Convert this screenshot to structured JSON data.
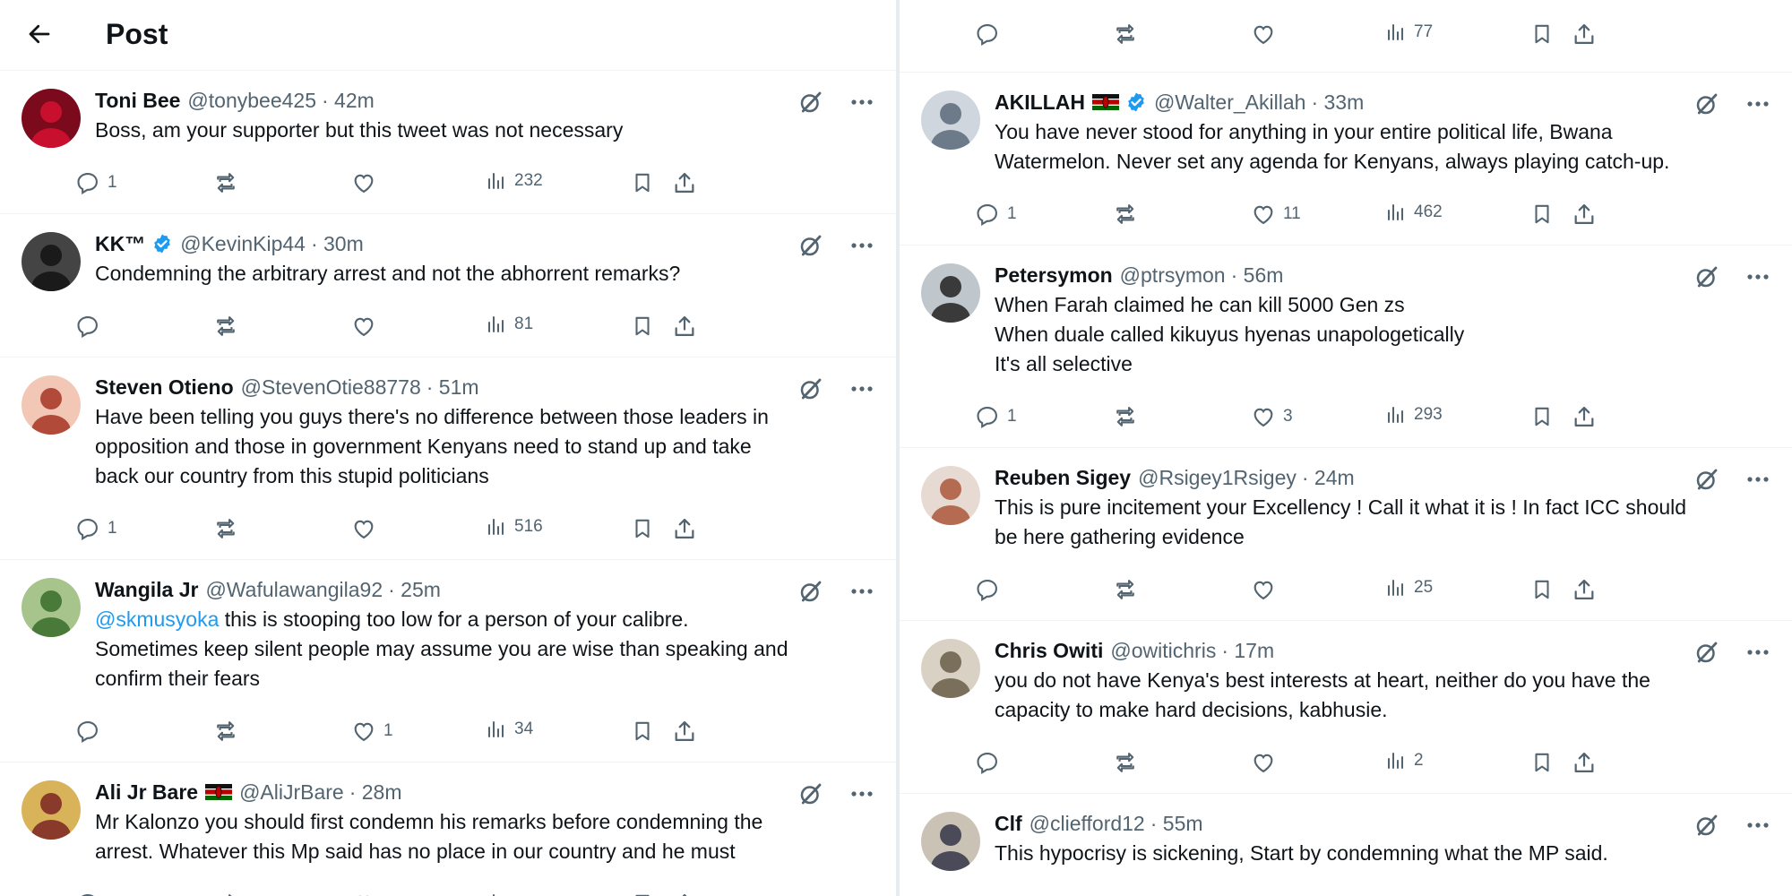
{
  "header": {
    "title": "Post"
  },
  "left_posts": [
    {
      "name": "Toni Bee",
      "handle": "@tonybee425",
      "time": "· 42m",
      "text": [
        "Boss, am your supporter but this tweet was not necessary"
      ],
      "replies": "1",
      "retweets": "",
      "likes": "",
      "views": "232"
    },
    {
      "name": "KK™",
      "handle": "@KevinKip44",
      "time": "· 30m",
      "verified": true,
      "text": [
        "Condemning the arbitrary arrest and not the abhorrent remarks?"
      ],
      "replies": "",
      "retweets": "",
      "likes": "",
      "views": "81"
    },
    {
      "name": "Steven Otieno",
      "handle": "@StevenOtie88778",
      "time": "· 51m",
      "text": [
        "Have been telling you guys there's no difference between those leaders in",
        "opposition and those in government Kenyans need to stand up and take",
        "back our country from this stupid politicians"
      ],
      "replies": "1",
      "retweets": "",
      "likes": "",
      "views": "516"
    },
    {
      "name": "Wangila Jr",
      "handle": "@Wafulawangila92",
      "time": "· 25m",
      "mention": "@skmusyoka",
      "text": [
        " this is stooping too low for a person of your calibre.",
        "Sometimes keep silent people may assume you are wise than speaking and",
        "confirm their fears"
      ],
      "replies": "",
      "retweets": "",
      "likes": "1",
      "views": "34"
    },
    {
      "name": "Ali Jr Bare",
      "handle": "@AliJrBare",
      "time": "· 28m",
      "flag": true,
      "text": [
        "Mr Kalonzo you should  first condemn his remarks before condemning the",
        "arrest. Whatever this Mp said has no place in our country and he must"
      ],
      "replies": "",
      "retweets": "",
      "likes": "",
      "views": ""
    }
  ],
  "right_top_actions": {
    "replies": "",
    "retweets": "",
    "likes": "",
    "views": "77"
  },
  "right_posts": [
    {
      "name": "AKILLAH",
      "handle": "@Walter_Akillah",
      "time": "· 33m",
      "flag": true,
      "verified": true,
      "text": [
        "You have never stood for anything in your entire political life, Bwana",
        "Watermelon. Never set any agenda for Kenyans, always playing catch-up."
      ],
      "replies": "1",
      "retweets": "",
      "likes": "11",
      "views": "462"
    },
    {
      "name": "Petersymon",
      "handle": "@ptrsymon",
      "time": "· 56m",
      "text": [
        "When Farah claimed he can kill 5000 Gen zs",
        "When duale called kikuyus hyenas unapologetically",
        "It's all selective"
      ],
      "replies": "1",
      "retweets": "",
      "likes": "3",
      "views": "293"
    },
    {
      "name": "Reuben Sigey",
      "handle": "@Rsigey1Rsigey",
      "time": "· 24m",
      "text": [
        "This is pure incitement your Excellency ! Call it what it is ! In fact ICC should",
        "be here gathering evidence"
      ],
      "replies": "",
      "retweets": "",
      "likes": "",
      "views": "25"
    },
    {
      "name": "Chris Owiti",
      "handle": "@owitichris",
      "time": "· 17m",
      "text": [
        "you do not have Kenya's best interests at heart, neither do you have the",
        "capacity to make hard decisions, kabhusie."
      ],
      "replies": "",
      "retweets": "",
      "likes": "",
      "views": "2"
    },
    {
      "name": "Clf",
      "handle": "@cliefford12",
      "time": "· 55m",
      "text": [
        "This hypocrisy is sickening, Start by condemning what the MP said."
      ],
      "replies": "",
      "retweets": "",
      "likes": "",
      "views": ""
    }
  ],
  "colors": {
    "accent": "#1d9bf0",
    "secondary_text": "#536471",
    "divider": "#eff3f4"
  }
}
